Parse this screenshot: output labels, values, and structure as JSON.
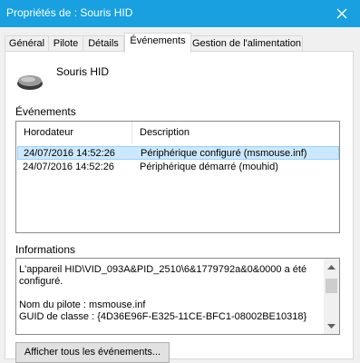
{
  "window": {
    "title": "Propriétés de : Souris HID",
    "close_icon": "close-icon"
  },
  "tabs": [
    {
      "label": "Général"
    },
    {
      "label": "Pilote"
    },
    {
      "label": "Détails"
    },
    {
      "label": "Événements",
      "active": true
    },
    {
      "label": "Gestion de l'alimentation"
    }
  ],
  "device": {
    "icon": "mouse-icon",
    "name": "Souris HID"
  },
  "events": {
    "section_label": "Événements",
    "columns": [
      "Horodateur",
      "Description"
    ],
    "rows": [
      {
        "timestamp": "24/07/2016 14:52:26",
        "description": "Périphérique configuré (msmouse.inf)",
        "selected": true
      },
      {
        "timestamp": "24/07/2016 14:52:26",
        "description": "Périphérique démarré (mouhid)",
        "selected": false
      }
    ]
  },
  "information": {
    "section_label": "Informations",
    "text": "L'appareil HID\\VID_093A&PID_2510\\6&1779792a&0&0000 a été configuré.\n\nNom du pilote : msmouse.inf\nGUID de classe : {4D36E96F-E325-11CE-BFC1-08002BE10318}"
  },
  "buttons": {
    "view_all": "Afficher tous les événements..."
  },
  "colors": {
    "titlebar": "#18a0e0",
    "selection": "#cce8ff",
    "selection_border": "#99d1ff"
  }
}
